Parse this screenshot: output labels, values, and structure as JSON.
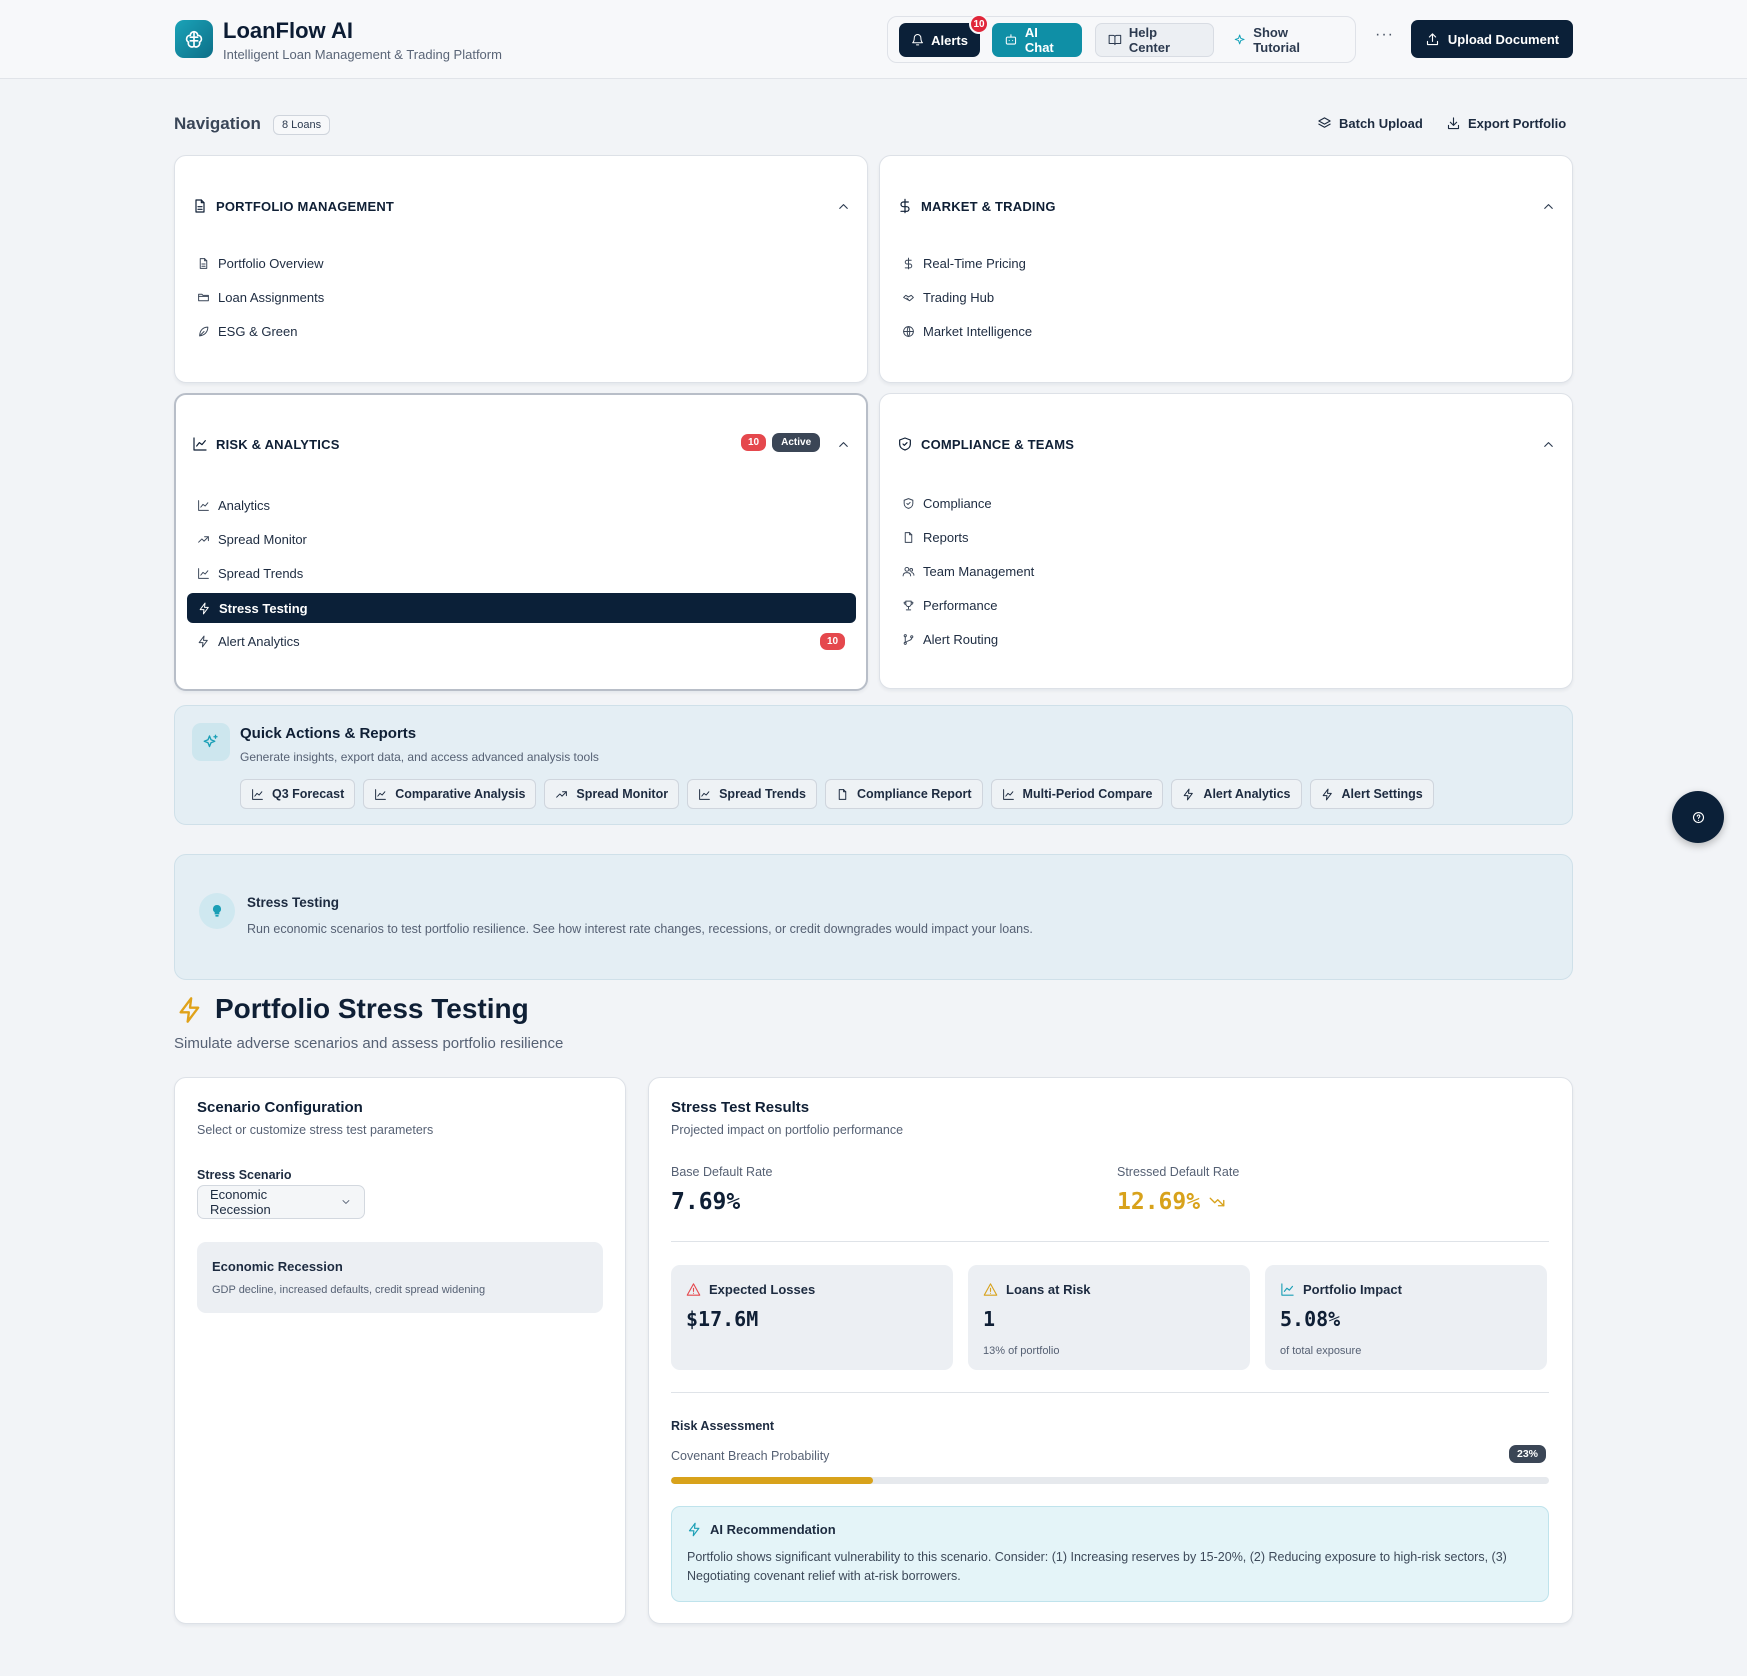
{
  "app": {
    "title": "LoanFlow AI",
    "subtitle": "Intelligent Loan Management & Trading Platform"
  },
  "header": {
    "alerts_label": "Alerts",
    "alerts_count": "10",
    "ai_chat_label": "AI Chat",
    "help_label": "Help Center",
    "tutorial_label": "Show Tutorial",
    "more_label": "···",
    "upload_label": "Upload Document"
  },
  "nav": {
    "label": "Navigation",
    "count": "8 Loans",
    "batch_upload": "Batch Upload",
    "export_portfolio": "Export Portfolio"
  },
  "sections": {
    "portfolio": {
      "title": "PORTFOLIO MANAGEMENT",
      "items": [
        "Portfolio Overview",
        "Loan Assignments",
        "ESG & Green"
      ]
    },
    "market": {
      "title": "MARKET & TRADING",
      "items": [
        "Real-Time Pricing",
        "Trading Hub",
        "Market Intelligence"
      ]
    },
    "risk": {
      "title": "RISK & ANALYTICS",
      "badge_count": "10",
      "badge_status": "Active",
      "items": [
        "Analytics",
        "Spread Monitor",
        "Spread Trends",
        "Stress Testing",
        "Alert Analytics"
      ],
      "item_badge": "10"
    },
    "compliance": {
      "title": "COMPLIANCE & TEAMS",
      "items": [
        "Compliance",
        "Reports",
        "Team Management",
        "Performance",
        "Alert Routing"
      ]
    }
  },
  "quick_actions": {
    "title": "Quick Actions & Reports",
    "subtitle": "Generate insights, export data, and access advanced analysis tools",
    "buttons": [
      "Q3 Forecast",
      "Comparative Analysis",
      "Spread Monitor",
      "Spread Trends",
      "Compliance Report",
      "Multi-Period Compare",
      "Alert Analytics",
      "Alert Settings"
    ]
  },
  "info_banner": {
    "title": "Stress Testing",
    "description": "Run economic scenarios to test portfolio resilience. See how interest rate changes, recessions, or credit downgrades would impact your loans."
  },
  "page": {
    "title": "Portfolio Stress Testing",
    "subtitle": "Simulate adverse scenarios and assess portfolio resilience"
  },
  "scenario": {
    "title": "Scenario Configuration",
    "subtitle": "Select or customize stress test parameters",
    "select_label": "Stress Scenario",
    "selected": "Economic Recession",
    "box_title": "Economic Recession",
    "box_desc": "GDP decline, increased defaults, credit spread widening"
  },
  "results": {
    "title": "Stress Test Results",
    "subtitle": "Projected impact on portfolio performance",
    "base_label": "Base Default Rate",
    "base_value": "7.69%",
    "stressed_label": "Stressed Default Rate",
    "stressed_value": "12.69%",
    "kpis": [
      {
        "label": "Expected Losses",
        "value": "$17.6M",
        "sub": ""
      },
      {
        "label": "Loans at Risk",
        "value": "1",
        "sub": "13% of portfolio"
      },
      {
        "label": "Portfolio Impact",
        "value": "5.08%",
        "sub": "of total exposure"
      }
    ],
    "risk_title": "Risk Assessment",
    "covenant_label": "Covenant Breach Probability",
    "covenant_pct": "23%",
    "covenant_value": 0.23,
    "ai_title": "AI Recommendation",
    "ai_text": "Portfolio shows significant vulnerability to this scenario. Consider: (1) Increasing reserves by 15-20%, (2) Reducing exposure to high-risk sectors, (3) Negotiating covenant relief with at-risk borrowers."
  },
  "colors": {
    "navy": "#0b2038",
    "teal": "#0f8fa6",
    "amber": "#d8a21b",
    "red": "#e5484d"
  }
}
